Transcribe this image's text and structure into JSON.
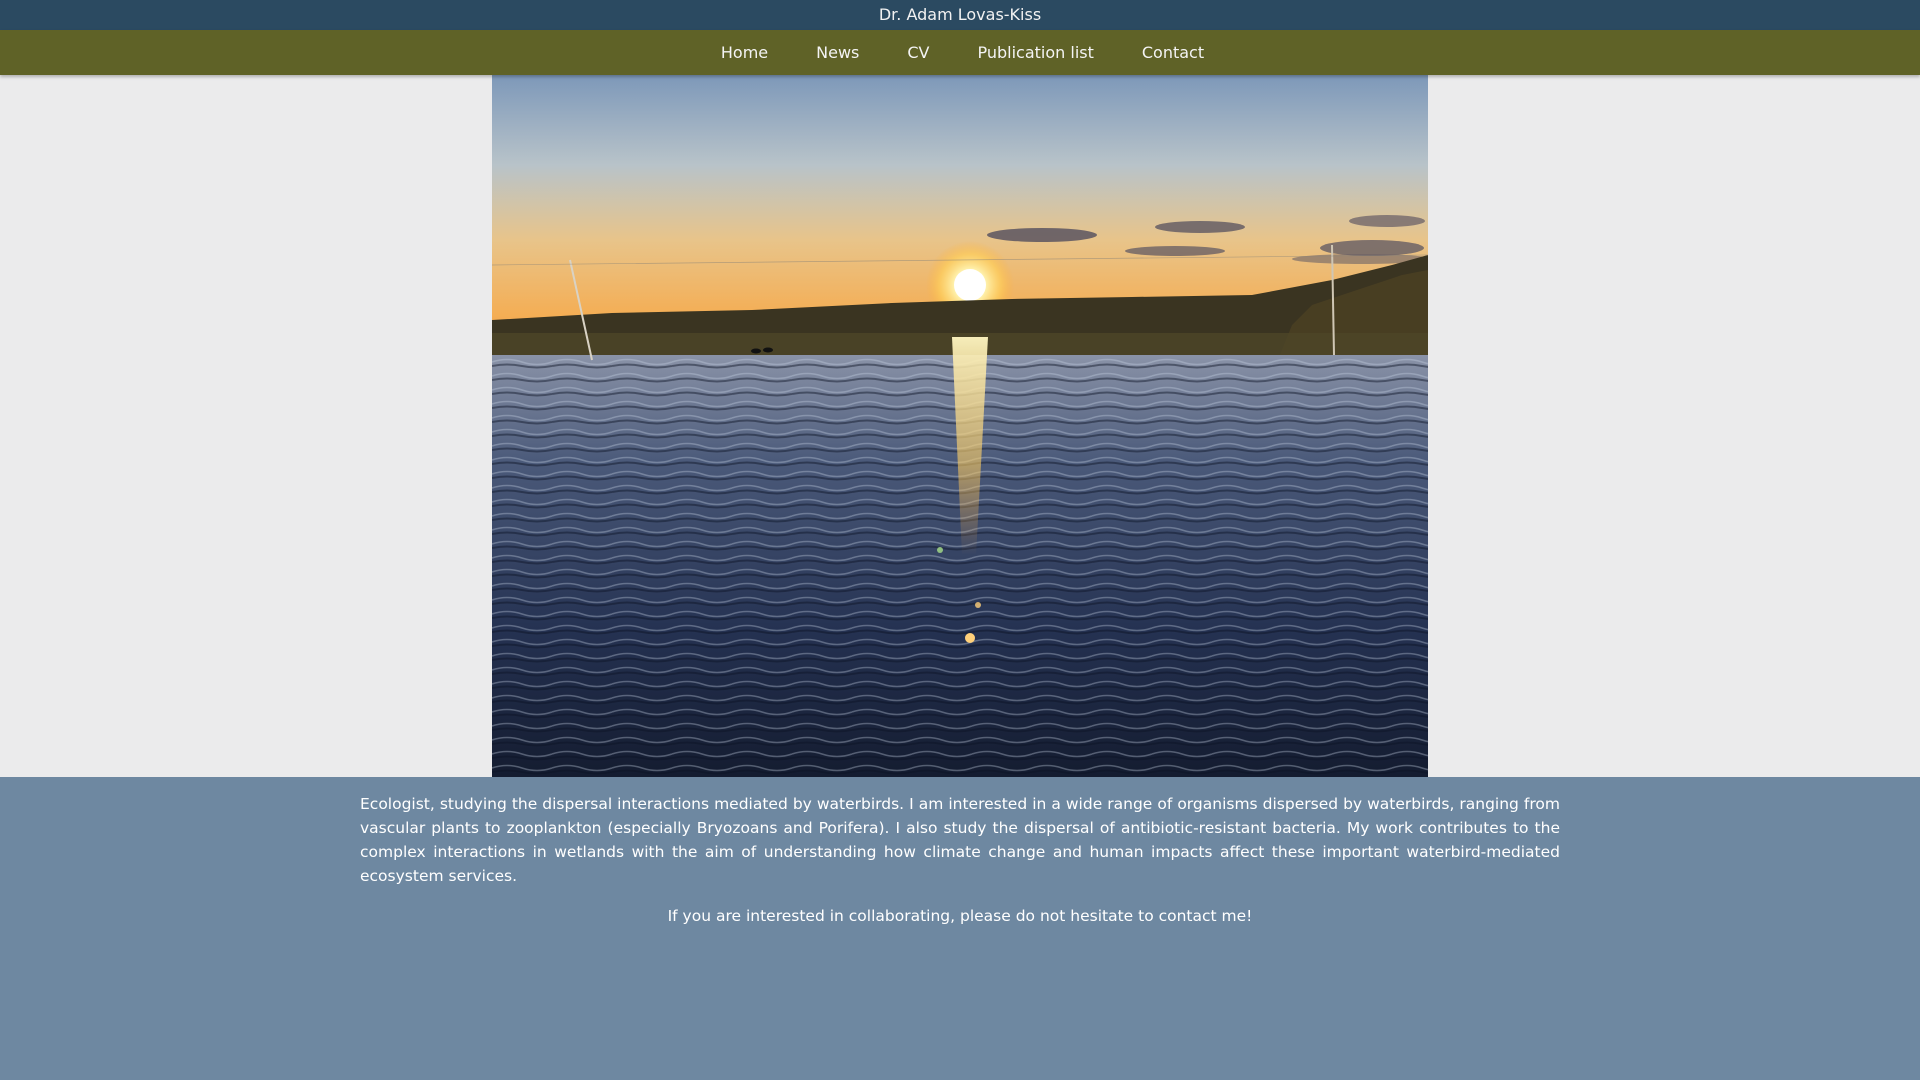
{
  "site": {
    "title": "Dr. Adam Lovas-Kiss"
  },
  "nav": {
    "items": [
      {
        "label": "Home"
      },
      {
        "label": "News"
      },
      {
        "label": "CV"
      },
      {
        "label": "Publication list"
      },
      {
        "label": "Contact"
      }
    ]
  },
  "hero": {
    "subject": "sunset-over-wetland-photo"
  },
  "content": {
    "intro": "Ecologist, studying the dispersal interactions mediated by waterbirds. I am interested in a wide range of organisms dispersed by waterbirds, ranging from vascular plants to zooplankton (especially Bryozoans and Porifera). I also study the dispersal of antibiotic-resistant bacteria. My work contributes to the complex interactions in wetlands with the aim of understanding how climate change and human impacts affect these important waterbird-mediated ecosystem services.",
    "collab": "If you are interested in collaborating, please do not hesitate to contact me!"
  },
  "colors": {
    "topbar": "#2b4a61",
    "navbar": "#5f6227",
    "hero_band": "#ebebec",
    "page_bg": "#6e88a1",
    "text": "#ffffff"
  }
}
